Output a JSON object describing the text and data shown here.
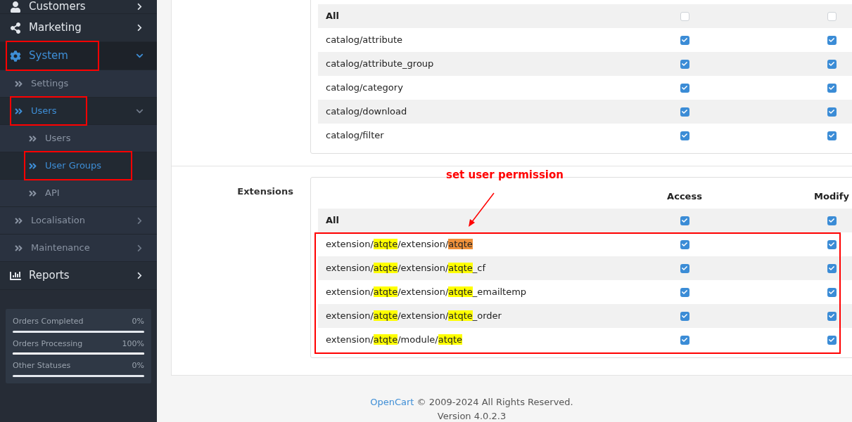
{
  "sidebar": {
    "items": [
      {
        "label": "Customers",
        "selected": false,
        "expanded": false,
        "has_submenu": true,
        "annotated": false
      },
      {
        "label": "Marketing",
        "selected": false,
        "expanded": false,
        "has_submenu": true,
        "annotated": false
      },
      {
        "label": "System",
        "selected": true,
        "expanded": true,
        "has_submenu": true,
        "annotated": true,
        "children": [
          {
            "label": "Settings",
            "selected": false,
            "expanded": false,
            "has_submenu": false,
            "annotated": false
          },
          {
            "label": "Users",
            "selected": true,
            "expanded": true,
            "has_submenu": true,
            "annotated": true,
            "children": [
              {
                "label": "Users",
                "selected": false,
                "expanded": false,
                "has_submenu": false,
                "annotated": false
              },
              {
                "label": "User Groups",
                "selected": true,
                "expanded": false,
                "has_submenu": false,
                "annotated": true
              },
              {
                "label": "API",
                "selected": false,
                "expanded": false,
                "has_submenu": false,
                "annotated": false
              }
            ]
          },
          {
            "label": "Localisation",
            "selected": false,
            "expanded": false,
            "has_submenu": true,
            "annotated": false
          },
          {
            "label": "Maintenance",
            "selected": false,
            "expanded": false,
            "has_submenu": true,
            "annotated": false
          }
        ]
      },
      {
        "label": "Reports",
        "selected": false,
        "expanded": false,
        "has_submenu": true,
        "annotated": false
      }
    ],
    "stats": [
      {
        "label": "Orders Completed",
        "reading": "0%",
        "level": 0
      },
      {
        "label": "Orders Processing",
        "reading": "100%",
        "level": 1
      },
      {
        "label": "Other Statuses",
        "reading": "0%",
        "level": 0
      }
    ]
  },
  "sections": [
    {
      "rows": [
        {
          "kind": "all",
          "segments": [
            {
              "text": "All"
            }
          ],
          "access": false,
          "modify": false,
          "boxed": false
        },
        {
          "kind": "route",
          "segments": [
            {
              "text": "catalog/attribute"
            }
          ],
          "access": true,
          "modify": true,
          "boxed": false
        },
        {
          "kind": "route",
          "segments": [
            {
              "text": "catalog/attribute_group"
            }
          ],
          "access": true,
          "modify": true,
          "boxed": false
        },
        {
          "kind": "route",
          "segments": [
            {
              "text": "catalog/category"
            }
          ],
          "access": true,
          "modify": true,
          "boxed": false
        },
        {
          "kind": "route",
          "segments": [
            {
              "text": "catalog/download"
            }
          ],
          "access": true,
          "modify": true,
          "boxed": false
        },
        {
          "kind": "route",
          "segments": [
            {
              "text": "catalog/filter"
            }
          ],
          "access": true,
          "modify": true,
          "boxed": false
        }
      ]
    },
    {
      "label": "Extensions",
      "columns": [
        "Access",
        "Modify"
      ],
      "annotation": "set user permission",
      "rows": [
        {
          "kind": "all",
          "segments": [
            {
              "text": "All"
            }
          ],
          "access": true,
          "modify": true,
          "boxed": false
        },
        {
          "kind": "route",
          "segments": [
            {
              "text": "extension/"
            },
            {
              "text": "atqte",
              "color": "#ffff00"
            },
            {
              "text": "/extension/"
            },
            {
              "text": "atqte",
              "color": "#f0913a"
            }
          ],
          "access": true,
          "modify": true,
          "boxed": true
        },
        {
          "kind": "route",
          "segments": [
            {
              "text": "extension/"
            },
            {
              "text": "atqte",
              "color": "#ffff00"
            },
            {
              "text": "/extension/"
            },
            {
              "text": "atqte",
              "color": "#ffff00"
            },
            {
              "text": "_cf"
            }
          ],
          "access": true,
          "modify": true,
          "boxed": true
        },
        {
          "kind": "route",
          "segments": [
            {
              "text": "extension/"
            },
            {
              "text": "atqte",
              "color": "#ffff00"
            },
            {
              "text": "/extension/"
            },
            {
              "text": "atqte",
              "color": "#ffff00"
            },
            {
              "text": "_emailtemp"
            }
          ],
          "access": true,
          "modify": true,
          "boxed": true
        },
        {
          "kind": "route",
          "segments": [
            {
              "text": "extension/"
            },
            {
              "text": "atqte",
              "color": "#ffff00"
            },
            {
              "text": "/extension/"
            },
            {
              "text": "atqte",
              "color": "#ffff00"
            },
            {
              "text": "_order"
            }
          ],
          "access": true,
          "modify": true,
          "boxed": true
        },
        {
          "kind": "route",
          "segments": [
            {
              "text": "extension/"
            },
            {
              "text": "atqte",
              "color": "#ffff00"
            },
            {
              "text": "/module/"
            },
            {
              "text": "atqte",
              "color": "#ffff00"
            }
          ],
          "access": true,
          "modify": true,
          "boxed": true
        }
      ]
    }
  ],
  "footer": {
    "link": "OpenCart",
    "copyright": "© 2009-2024 All Rights Reserved.",
    "version": "Version 4.0.2.3"
  }
}
